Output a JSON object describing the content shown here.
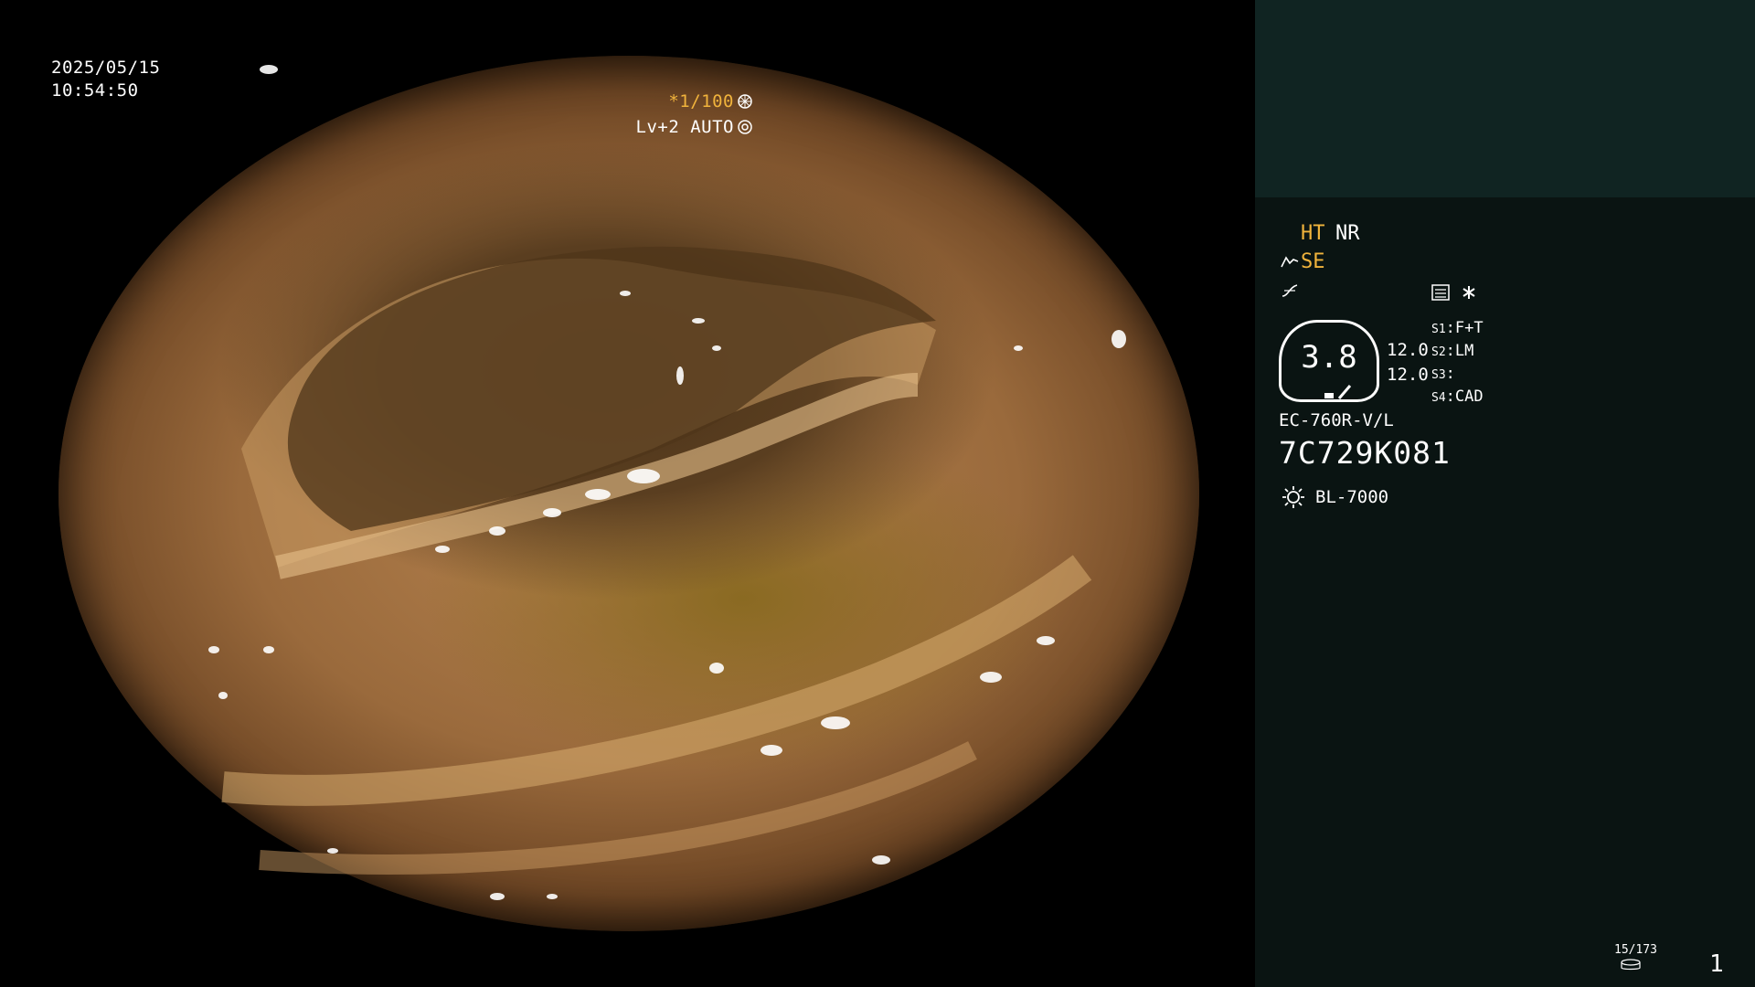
{
  "overlay": {
    "date": "2025/05/15",
    "time": "10:54:50",
    "zoom": "*1/100",
    "level": "Lv+2 AUTO"
  },
  "panel": {
    "ht": "HT",
    "nr": "NR",
    "se": "SE",
    "ring_value": "3.8",
    "value_1": "12.0",
    "value_2": "12.0",
    "s1_label": "S1",
    "s1_value": "F+T",
    "s2_label": "S2",
    "s2_value": "LM",
    "s3_label": "S3",
    "s3_value": "",
    "s4_label": "S4",
    "s4_value": "CAD",
    "scope_model": "EC-760R-V/L",
    "serial": "7C729K081",
    "light_source": "BL-7000",
    "image_counter": "15/173",
    "page_number": "1"
  },
  "colors": {
    "highlight": "#f0b33c",
    "panel_bg": "#0a1412",
    "panel_top_bg": "#102422"
  }
}
